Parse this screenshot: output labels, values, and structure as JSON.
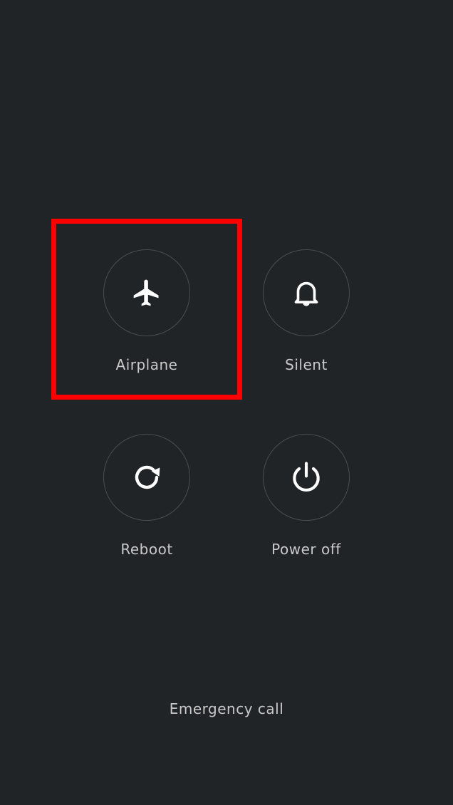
{
  "power_menu": {
    "actions": [
      {
        "id": "airplane",
        "label": "Airplane",
        "icon": "airplane-icon"
      },
      {
        "id": "silent",
        "label": "Silent",
        "icon": "bell-icon"
      },
      {
        "id": "reboot",
        "label": "Reboot",
        "icon": "reboot-icon"
      },
      {
        "id": "power_off",
        "label": "Power off",
        "icon": "power-icon"
      }
    ],
    "emergency_label": "Emergency call"
  },
  "colors": {
    "background": "#202426",
    "circle_border": "#4a4e50",
    "icon": "#ffffff",
    "label": "#c9c9c9",
    "highlight": "#ff0000"
  }
}
